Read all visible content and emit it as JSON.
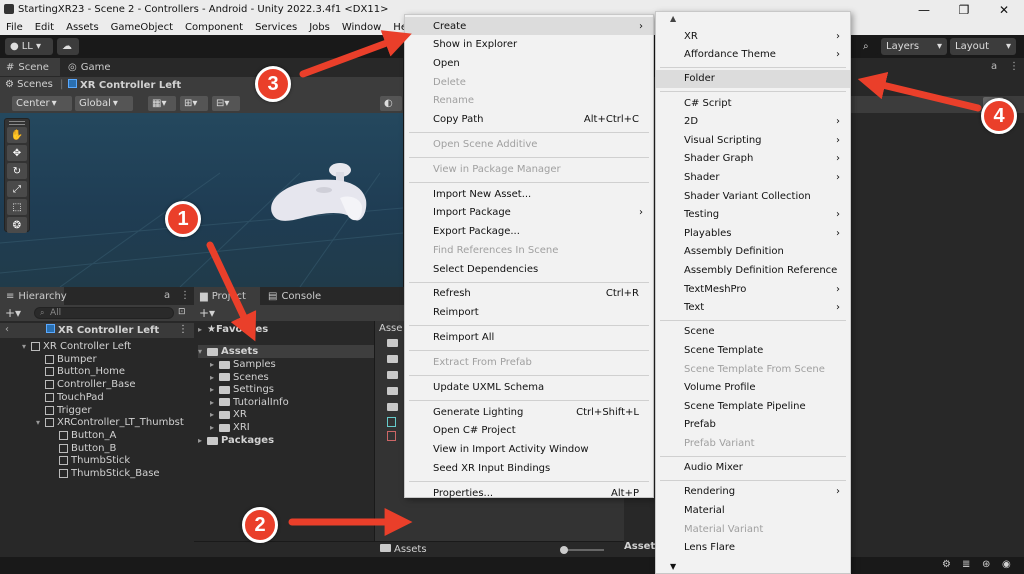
{
  "window": {
    "title": "StartingXR23 - Scene 2 - Controllers - Android - Unity 2022.3.4f1 <DX11>",
    "minimize": "—",
    "maximize": "❐",
    "close": "✕"
  },
  "menubar": [
    "File",
    "Edit",
    "Assets",
    "GameObject",
    "Component",
    "Services",
    "Jobs",
    "Window",
    "Help"
  ],
  "toolbar": {
    "account": "LL ▾",
    "cloud": "☁",
    "search_icon": "⌕",
    "layers": "Layers",
    "layout": "Layout"
  },
  "scene_tabs": {
    "scene": "Scene",
    "game": "Game"
  },
  "scene_bar": {
    "scenes": "Scenes",
    "prefab": "XR Controller Left",
    "center": "Center",
    "global": "Global"
  },
  "hierarchy": {
    "tab": "Hierarchy",
    "search_placeholder": "All",
    "root": "XR Controller Left",
    "items": [
      {
        "label": "XR Controller Left",
        "depth": 1
      },
      {
        "label": "Bumper",
        "depth": 2
      },
      {
        "label": "Button_Home",
        "depth": 2
      },
      {
        "label": "Controller_Base",
        "depth": 2
      },
      {
        "label": "TouchPad",
        "depth": 2
      },
      {
        "label": "Trigger",
        "depth": 2
      },
      {
        "label": "XRController_LT_Thumbst",
        "depth": 2
      },
      {
        "label": "Button_A",
        "depth": 3
      },
      {
        "label": "Button_B",
        "depth": 3
      },
      {
        "label": "ThumbStick",
        "depth": 3
      },
      {
        "label": "ThumbStick_Base",
        "depth": 3
      }
    ]
  },
  "project": {
    "tab_project": "Project",
    "tab_console": "Console",
    "favorites": "Favorites",
    "assets": "Assets",
    "folders": [
      "Samples",
      "Scenes",
      "Settings",
      "TutorialInfo",
      "XR",
      "XRI"
    ],
    "packages": "Packages",
    "assets_col_header": "Asse",
    "footer_path": "Assets",
    "inspector_footer": "Asset"
  },
  "context_menu": {
    "items": [
      {
        "label": "Create",
        "chev": true,
        "hl": true
      },
      {
        "label": "Show in Explorer"
      },
      {
        "label": "Open"
      },
      {
        "label": "Delete",
        "dis": true
      },
      {
        "label": "Rename",
        "dis": true
      },
      {
        "label": "Copy Path",
        "sc": "Alt+Ctrl+C"
      },
      {
        "sep": true
      },
      {
        "label": "Open Scene Additive",
        "dis": true
      },
      {
        "sep": true
      },
      {
        "label": "View in Package Manager",
        "dis": true
      },
      {
        "sep": true
      },
      {
        "label": "Import New Asset..."
      },
      {
        "label": "Import Package",
        "chev": true
      },
      {
        "label": "Export Package..."
      },
      {
        "label": "Find References In Scene",
        "dis": true
      },
      {
        "label": "Select Dependencies"
      },
      {
        "sep": true
      },
      {
        "label": "Refresh",
        "sc": "Ctrl+R"
      },
      {
        "label": "Reimport"
      },
      {
        "sep": true
      },
      {
        "label": "Reimport All"
      },
      {
        "sep": true
      },
      {
        "label": "Extract From Prefab",
        "dis": true
      },
      {
        "sep": true
      },
      {
        "label": "Update UXML Schema"
      },
      {
        "sep": true
      },
      {
        "label": "Generate Lighting",
        "sc": "Ctrl+Shift+L"
      },
      {
        "label": "Open C# Project"
      },
      {
        "label": "View in Import Activity Window"
      },
      {
        "label": "Seed XR Input Bindings"
      },
      {
        "sep": true
      },
      {
        "label": "Properties...",
        "sc": "Alt+P"
      }
    ]
  },
  "submenu": {
    "scroll_up": "▲",
    "scroll_down": "▼",
    "items": [
      {
        "label": "XR",
        "chev": true
      },
      {
        "label": "Affordance Theme",
        "chev": true
      },
      {
        "sep": true
      },
      {
        "label": "Folder",
        "hl": true
      },
      {
        "sep": true
      },
      {
        "label": "C# Script"
      },
      {
        "label": "2D",
        "chev": true
      },
      {
        "label": "Visual Scripting",
        "chev": true
      },
      {
        "label": "Shader Graph",
        "chev": true
      },
      {
        "label": "Shader",
        "chev": true
      },
      {
        "label": "Shader Variant Collection"
      },
      {
        "label": "Testing",
        "chev": true
      },
      {
        "label": "Playables",
        "chev": true
      },
      {
        "label": "Assembly Definition"
      },
      {
        "label": "Assembly Definition Reference"
      },
      {
        "label": "TextMeshPro",
        "chev": true
      },
      {
        "label": "Text",
        "chev": true
      },
      {
        "sep": true
      },
      {
        "label": "Scene"
      },
      {
        "label": "Scene Template"
      },
      {
        "label": "Scene Template From Scene",
        "dis": true
      },
      {
        "label": "Volume Profile"
      },
      {
        "label": "Scene Template Pipeline"
      },
      {
        "label": "Prefab"
      },
      {
        "label": "Prefab Variant",
        "dis": true
      },
      {
        "sep": true
      },
      {
        "label": "Audio Mixer"
      },
      {
        "sep": true
      },
      {
        "label": "Rendering",
        "chev": true
      },
      {
        "label": "Material"
      },
      {
        "label": "Material Variant",
        "dis": true
      },
      {
        "label": "Lens Flare"
      }
    ]
  },
  "annotations": [
    "1",
    "2",
    "3",
    "4"
  ],
  "colors": {
    "annotation_red": "#ea3f2a",
    "menu_bg": "#f2f2f2",
    "editor_bg": "#282828",
    "scene_sky": "#24485e"
  }
}
